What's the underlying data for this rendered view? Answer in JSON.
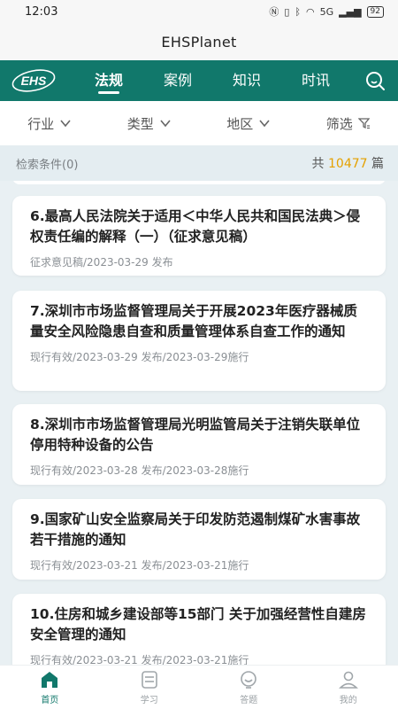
{
  "status": {
    "time": "12:03",
    "network": "5G",
    "battery": "92"
  },
  "app": {
    "title": "EHSPlanet",
    "logo_text": "EHS"
  },
  "tabs": [
    {
      "label": "法规",
      "active": true
    },
    {
      "label": "案例",
      "active": false
    },
    {
      "label": "知识",
      "active": false
    },
    {
      "label": "时讯",
      "active": false
    }
  ],
  "filters": {
    "industry": "行业",
    "type": "类型",
    "region": "地区",
    "screen": "筛选"
  },
  "summary": {
    "conditions": "检索条件(0)",
    "prefix": "共",
    "total": "10477",
    "suffix": "篇"
  },
  "items": [
    {
      "title": "6.最高人民法院关于适用＜中华人民共和国民法典＞侵权责任编的解释（一）（征求意见稿）",
      "meta": "征求意见稿/2023-03-29 发布"
    },
    {
      "title": "7.深圳市市场监督管理局关于开展2023年医疗器械质量安全风险隐患自查和质量管理体系自查工作的通知",
      "meta": "现行有效/2023-03-29 发布/2023-03-29施行"
    },
    {
      "title": "8.深圳市市场监督管理局光明监管局关于注销失联单位停用特种设备的公告",
      "meta": "现行有效/2023-03-28 发布/2023-03-28施行"
    },
    {
      "title": "9.国家矿山安全监察局关于印发防范遏制煤矿水害事故若干措施的通知",
      "meta": "现行有效/2023-03-21 发布/2023-03-21施行"
    },
    {
      "title": "10.住房和城乡建设部等15部门 关于加强经营性自建房安全管理的通知",
      "meta": "现行有效/2023-03-21 发布/2023-03-21施行"
    }
  ],
  "nav": [
    {
      "label": "首页",
      "active": true
    },
    {
      "label": "学习",
      "active": false
    },
    {
      "label": "答题",
      "active": false
    },
    {
      "label": "我的",
      "active": false
    }
  ],
  "colors": {
    "brand": "#11786b",
    "highlight": "#e5a100"
  }
}
